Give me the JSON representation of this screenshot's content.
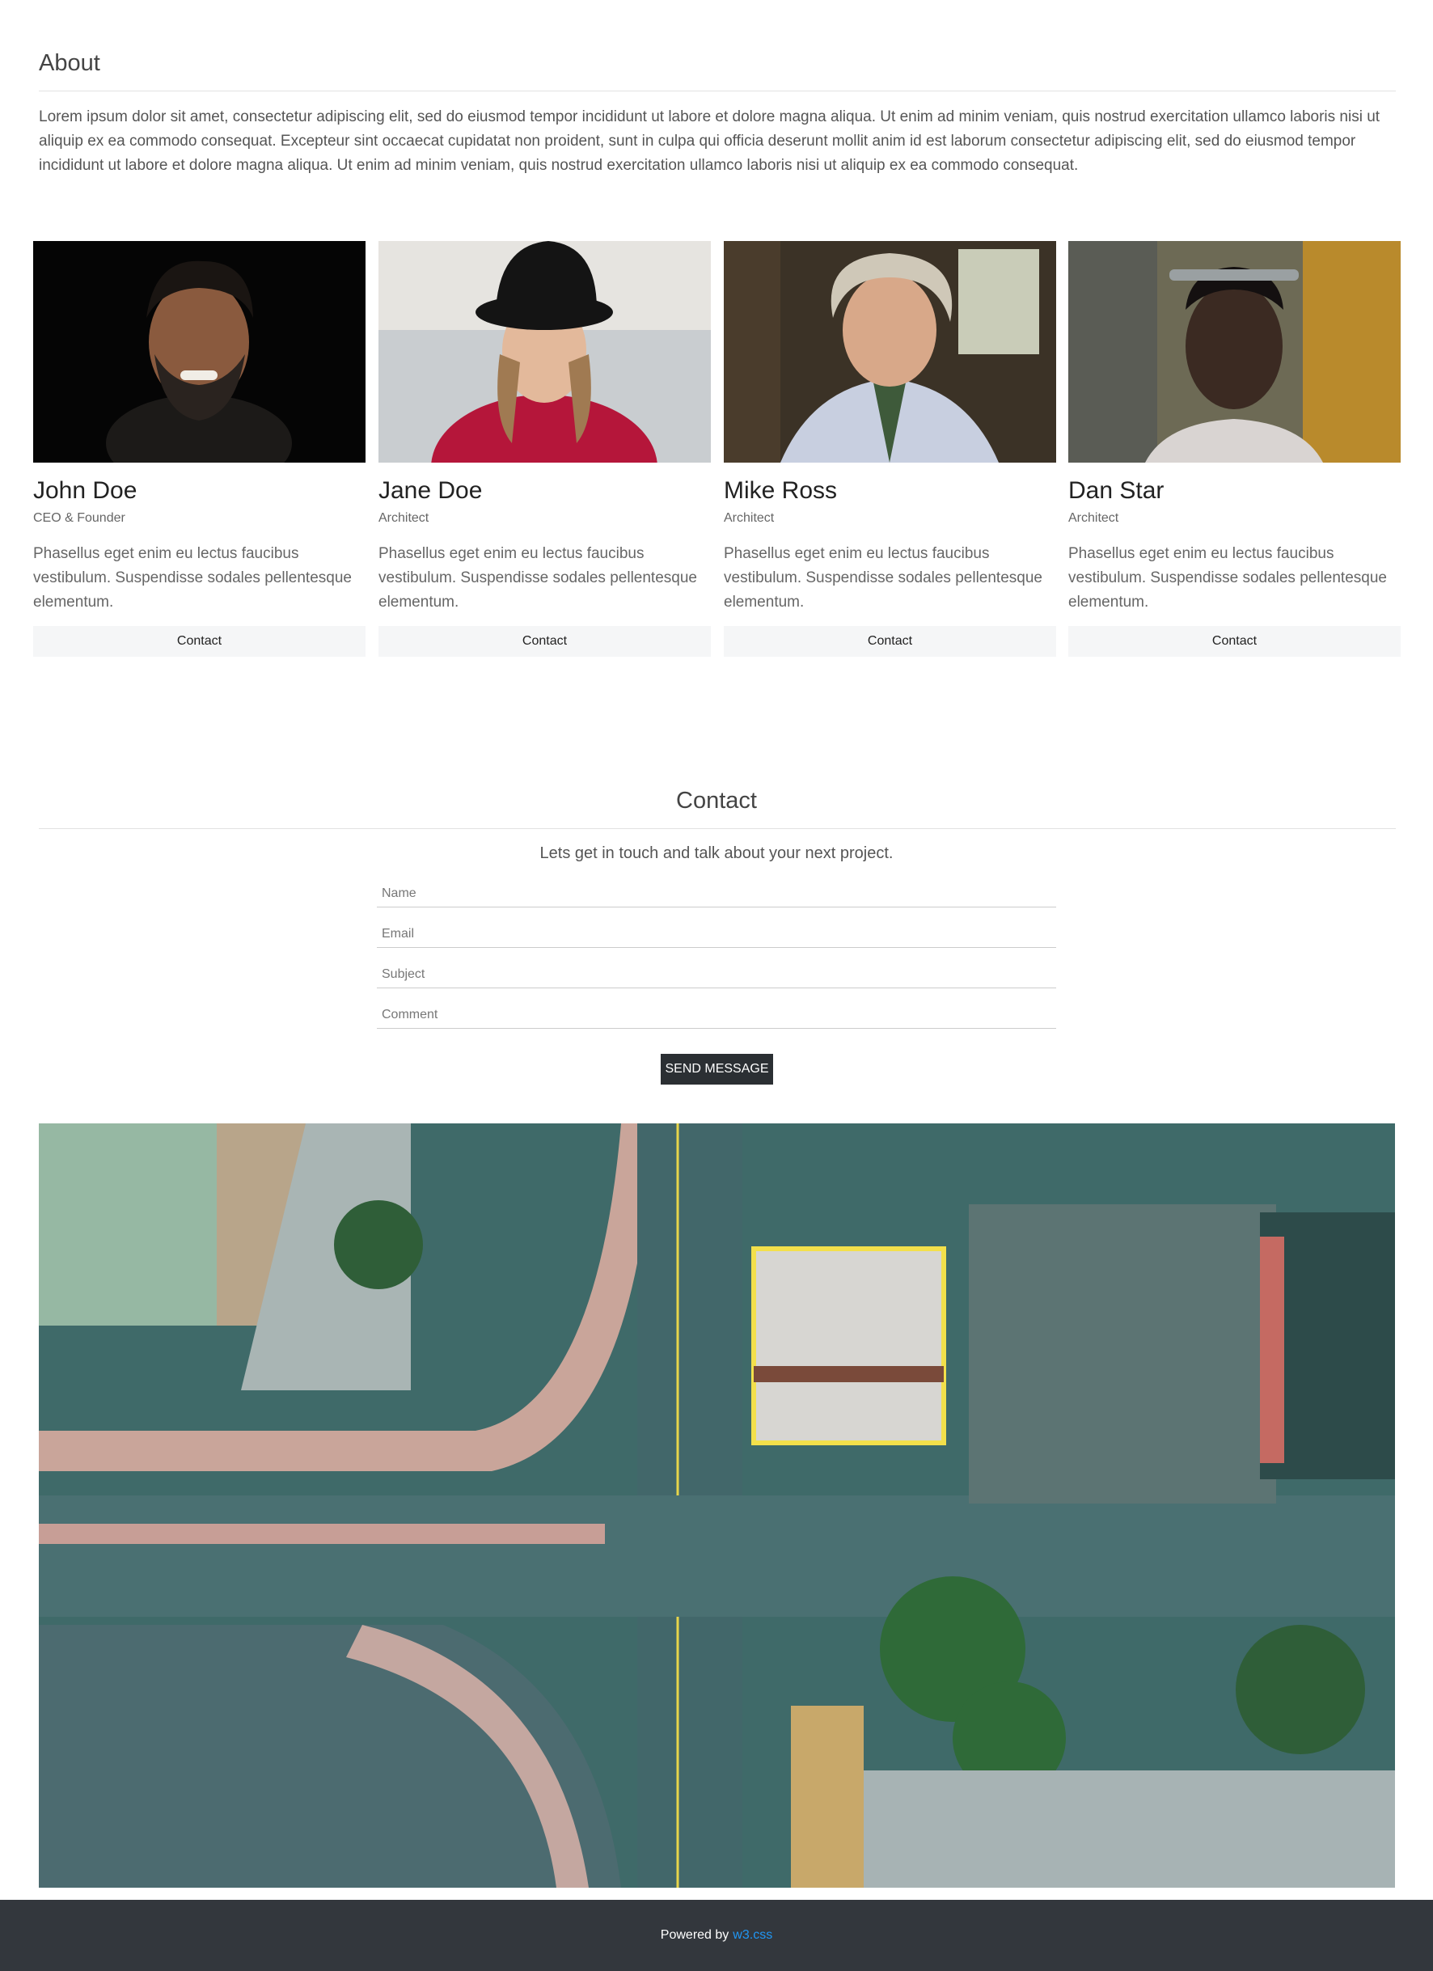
{
  "about": {
    "title": "About",
    "text": "Lorem ipsum dolor sit amet, consectetur adipiscing elit, sed do eiusmod tempor incididunt ut labore et dolore magna aliqua. Ut enim ad minim veniam, quis nostrud exercitation ullamco laboris nisi ut aliquip ex ea commodo consequat. Excepteur sint occaecat cupidatat non proident, sunt in culpa qui officia deserunt mollit anim id est laborum consectetur adipiscing elit, sed do eiusmod tempor incididunt ut labore et dolore magna aliqua. Ut enim ad minim veniam, quis nostrud exercitation ullamco laboris nisi ut aliquip ex ea commodo consequat."
  },
  "team": [
    {
      "name": "John Doe",
      "role": "CEO & Founder",
      "bio": "Phasellus eget enim eu lectus faucibus vestibulum. Suspendisse sodales pellentesque elementum.",
      "button": "Contact"
    },
    {
      "name": "Jane Doe",
      "role": "Architect",
      "bio": "Phasellus eget enim eu lectus faucibus vestibulum. Suspendisse sodales pellentesque elementum.",
      "button": "Contact"
    },
    {
      "name": "Mike Ross",
      "role": "Architect",
      "bio": "Phasellus eget enim eu lectus faucibus vestibulum. Suspendisse sodales pellentesque elementum.",
      "button": "Contact"
    },
    {
      "name": "Dan Star",
      "role": "Architect",
      "bio": "Phasellus eget enim eu lectus faucibus vestibulum. Suspendisse sodales pellentesque elementum.",
      "button": "Contact"
    }
  ],
  "contact": {
    "title": "Contact",
    "subtitle": "Lets get in touch and talk about your next project.",
    "fields": {
      "name_placeholder": "Name",
      "email_placeholder": "Email",
      "subject_placeholder": "Subject",
      "comment_placeholder": "Comment"
    },
    "send_label": "SEND MESSAGE"
  },
  "footer": {
    "powered_by": "Powered by",
    "link_text": "w3.css"
  },
  "colors": {
    "footer_bg": "#33373d",
    "link": "#2196f3",
    "send_button_bg": "#2b2f33"
  }
}
